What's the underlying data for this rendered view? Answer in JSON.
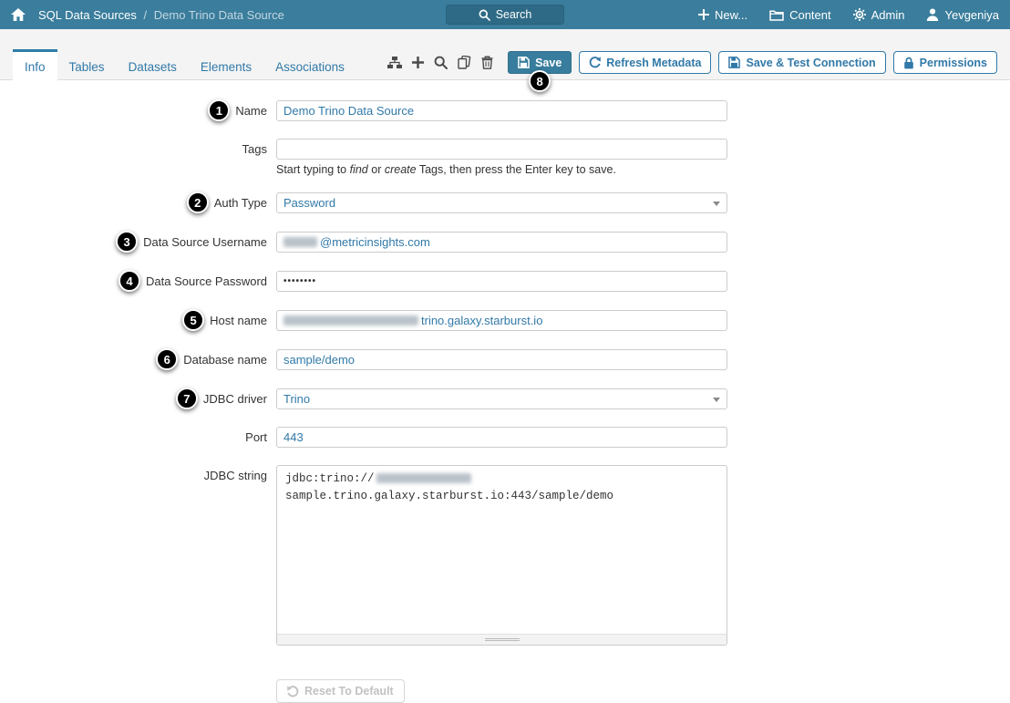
{
  "colors": {
    "navbar_bg": "#3a7d9c",
    "search_bg": "#2e6a85",
    "accent_blue": "#3179a8",
    "active_tab_border": "#2e7ca6",
    "save_button_bg": "#387d9d",
    "balloon_bg": "#000000",
    "band_bg": "#f4f4f4",
    "input_text_blue": "#3179a8",
    "disabled_text": "#c2c2c2"
  },
  "navbar": {
    "breadcrumb": {
      "section": "SQL Data Sources",
      "separator": "/",
      "page": "Demo Trino Data Source"
    },
    "search_label": "Search",
    "menu": [
      {
        "label": "New...",
        "icon": "plus-icon"
      },
      {
        "label": "Content",
        "icon": "folder-icon"
      },
      {
        "label": "Admin",
        "icon": "gear-icon"
      },
      {
        "label": "Yevgeniya",
        "icon": "user-icon"
      }
    ]
  },
  "tabs": [
    {
      "label": "Info",
      "active": true
    },
    {
      "label": "Tables",
      "active": false
    },
    {
      "label": "Datasets",
      "active": false
    },
    {
      "label": "Elements",
      "active": false
    },
    {
      "label": "Associations",
      "active": false
    }
  ],
  "toolbar": {
    "icons": [
      "hierarchy-icon",
      "add-icon",
      "search-icon",
      "copy-icon",
      "delete-icon"
    ],
    "save_label": "Save",
    "refresh_label": "Refresh Metadata",
    "save_test_label": "Save & Test Connection",
    "permissions_label": "Permissions"
  },
  "callouts": {
    "1": "1",
    "2": "2",
    "3": "3",
    "4": "4",
    "5": "5",
    "6": "6",
    "7": "7",
    "8": "8"
  },
  "form": {
    "name": {
      "label": "Name",
      "value": "Demo Trino Data Source"
    },
    "tags": {
      "label": "Tags",
      "value": "",
      "help": [
        "Start typing to ",
        "find",
        " or ",
        "create",
        " Tags, then press the Enter key to save."
      ]
    },
    "auth_type": {
      "label": "Auth Type",
      "value": "Password"
    },
    "username": {
      "label": "Data Source Username",
      "suffix": "@metricinsights.com"
    },
    "password": {
      "label": "Data Source Password",
      "value": "••••••••"
    },
    "host": {
      "label": "Host name",
      "suffix": "trino.galaxy.starburst.io"
    },
    "database": {
      "label": "Database name",
      "value": "sample/demo"
    },
    "jdbc_driver": {
      "label": "JDBC driver",
      "value": "Trino"
    },
    "port": {
      "label": "Port",
      "value": "443"
    },
    "jdbc_string": {
      "label": "JDBC string",
      "line1_prefix": "jdbc:trino://",
      "line2": "sample.trino.galaxy.starburst.io:443/sample/demo"
    },
    "reset_label": "Reset To Default"
  }
}
